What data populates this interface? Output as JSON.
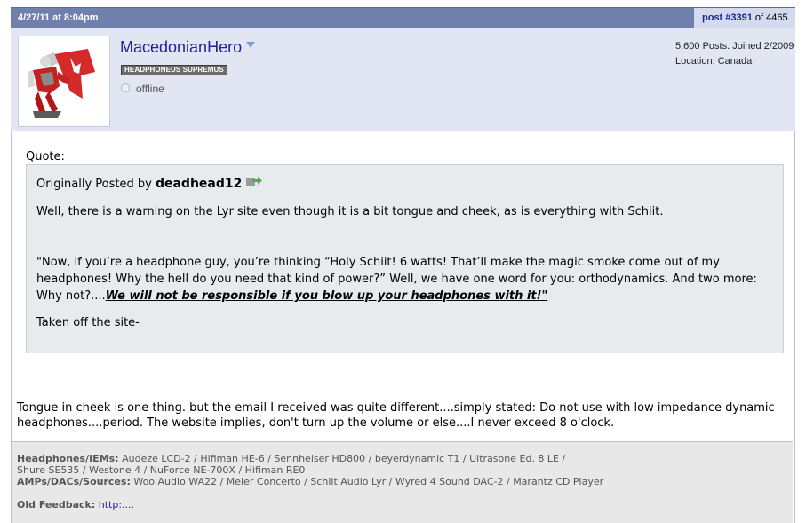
{
  "post": {
    "date": "4/27/11 at 8:04pm",
    "post_label": "post #3391",
    "of_total": " of 4465"
  },
  "user": {
    "username": "MacedonianHero",
    "title": "HEADPHONEUS SUPREMUS",
    "status": "offline",
    "stats_posts": "5,600 Posts. Joined 2/2009",
    "stats_location": "Location: Canada"
  },
  "quote": {
    "label": "Quote:",
    "by_prefix": "Originally Posted by ",
    "by_user": "deadhead12",
    "p1": "Well, there is a warning on the Lyr site even though it is a bit tongue and cheek, as is everything with Schiit.",
    "p2_text": "\"Now, if you’re a headphone guy, you’re thinking “Holy Schiit! 6 watts! That’ll make the magic smoke come out of my headphones! Why the hell do you need that kind of power?” Well, we have one word for you: orthodynamics. And two more: Why not?....",
    "p2_warning": "We will not be responsible if you blow up your headphones with it!\"",
    "p3": "Taken off the site-"
  },
  "body": {
    "text": "Tongue in cheek is one thing. but the email I received was quite different....simply stated: Do not use with low impedance dynamic headphones....period. The website implies, don't turn up the volume or else....I never exceed 8 o'clock."
  },
  "signature": {
    "headphones_label": "Headphones/IEMs:",
    "headphones_value": " Audeze LCD-2 / Hifiman HE-6 / Sennheiser HD800 / beyerdynamic T1 / Ultrasone Ed. 8 LE /",
    "headphones_value2": "Shure SE535 / Westone 4 / NuForce NE-700X / Hifiman RE0",
    "amps_label": "AMPs/DACs/Sources:",
    "amps_value": " Woo Audio WA22 / Meier Concerto / Schiit Audio Lyr / Wyred 4 Sound DAC-2 / Marantz CD Player",
    "feedback_label": "Old Feedback:",
    "feedback_link": "http:...."
  },
  "colors": {
    "header_bg": "#7080ad",
    "user_row_bg": "#e2e6f2",
    "link": "#22229c",
    "quote_bg": "#e8ebee",
    "signature_bg": "#e8e8e8"
  }
}
